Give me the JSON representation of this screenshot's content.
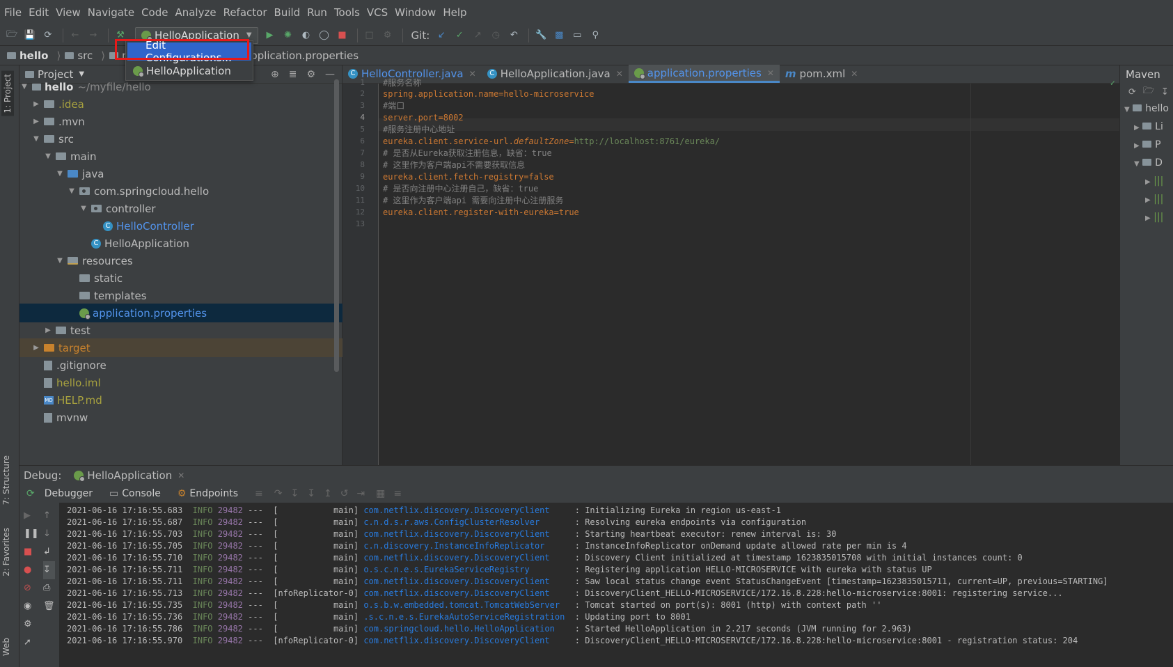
{
  "menubar": [
    "File",
    "Edit",
    "View",
    "Navigate",
    "Code",
    "Analyze",
    "Refactor",
    "Build",
    "Run",
    "Tools",
    "VCS",
    "Window",
    "Help"
  ],
  "toolbar": {
    "run_config": "HelloApplication",
    "git_label": "Git:"
  },
  "run_dropdown": {
    "edit_configurations": "Edit Configurations...",
    "app_item": "HelloApplication"
  },
  "breadcrumb": [
    "hello",
    "src",
    "main",
    "resources",
    "application.properties"
  ],
  "left_stripe": {
    "project": "1: Project",
    "structure": "7: Structure",
    "favorites": "2: Favorites",
    "web": "Web"
  },
  "project_panel": {
    "title": "Project",
    "tree": [
      {
        "label": "hello",
        "suffix": "~/myfile/hello"
      },
      {
        "label": ".idea"
      },
      {
        "label": ".mvn"
      },
      {
        "label": "src"
      },
      {
        "label": "main"
      },
      {
        "label": "java"
      },
      {
        "label": "com.springcloud.hello"
      },
      {
        "label": "controller"
      },
      {
        "label": "HelloController"
      },
      {
        "label": "HelloApplication"
      },
      {
        "label": "resources"
      },
      {
        "label": "static"
      },
      {
        "label": "templates"
      },
      {
        "label": "application.properties"
      },
      {
        "label": "test"
      },
      {
        "label": "target"
      },
      {
        "label": ".gitignore"
      },
      {
        "label": "hello.iml"
      },
      {
        "label": "HELP.md"
      },
      {
        "label": "mvnw"
      }
    ]
  },
  "editor_tabs": [
    {
      "label": "HelloController.java"
    },
    {
      "label": "HelloApplication.java"
    },
    {
      "label": "application.properties"
    },
    {
      "label": "pom.xml"
    }
  ],
  "editor": {
    "line_numbers": [
      "1",
      "2",
      "3",
      "4",
      "5",
      "6",
      "7",
      "8",
      "9",
      "10",
      "11",
      "12",
      "13"
    ],
    "lines": [
      {
        "comment": "#服务名称"
      },
      {
        "key": "spring.application.name",
        "value": "hello-microservice"
      },
      {
        "comment": "#端口"
      },
      {
        "key": "server.port",
        "value": "8002"
      },
      {
        "comment": "#服务注册中心地址"
      },
      {
        "key": "eureka.client.service-url.",
        "key_italic": "defaultZone",
        "value": "http://localhost:8761/eureka/"
      },
      {
        "comment": "# 是否从Eureka获取注册信息，缺省：true"
      },
      {
        "comment": "# 这里作为客户端api不需要获取信息"
      },
      {
        "key": "eureka.client.fetch-registry",
        "value": "false"
      },
      {
        "comment": "# 是否向注册中心注册自己，缺省：true"
      },
      {
        "comment": "# 这里作为客户端api 需要向注册中心注册服务"
      },
      {
        "key": "eureka.client.register-with-eureka",
        "value": "true"
      },
      {}
    ]
  },
  "maven": {
    "title": "Maven",
    "items": [
      "hello",
      "Li",
      "P",
      "D"
    ]
  },
  "debug": {
    "label": "Debug:",
    "session": "HelloApplication",
    "tabs": [
      "Debugger",
      "Console",
      "Endpoints"
    ],
    "log": [
      {
        "ts": "2021-06-16 17:16:55.683",
        "level": "INFO",
        "pid": "29482",
        "thread": "---  [           main]",
        "logger": "com.netflix.discovery.DiscoveryClient   ",
        "msg": ": Initializing Eureka in region us-east-1"
      },
      {
        "ts": "2021-06-16 17:16:55.687",
        "level": "INFO",
        "pid": "29482",
        "thread": "---  [           main]",
        "logger": "c.n.d.s.r.aws.ConfigClusterResolver     ",
        "msg": ": Resolving eureka endpoints via configuration"
      },
      {
        "ts": "2021-06-16 17:16:55.703",
        "level": "INFO",
        "pid": "29482",
        "thread": "---  [           main]",
        "logger": "com.netflix.discovery.DiscoveryClient   ",
        "msg": ": Starting heartbeat executor: renew interval is: 30"
      },
      {
        "ts": "2021-06-16 17:16:55.705",
        "level": "INFO",
        "pid": "29482",
        "thread": "---  [           main]",
        "logger": "c.n.discovery.InstanceInfoReplicator    ",
        "msg": ": InstanceInfoReplicator onDemand update allowed rate per min is 4"
      },
      {
        "ts": "2021-06-16 17:16:55.710",
        "level": "INFO",
        "pid": "29482",
        "thread": "---  [           main]",
        "logger": "com.netflix.discovery.DiscoveryClient   ",
        "msg": ": Discovery Client initialized at timestamp 1623835015708 with initial instances count: 0"
      },
      {
        "ts": "2021-06-16 17:16:55.711",
        "level": "INFO",
        "pid": "29482",
        "thread": "---  [           main]",
        "logger": "o.s.c.n.e.s.EurekaServiceRegistry       ",
        "msg": ": Registering application HELLO-MICROSERVICE with eureka with status UP"
      },
      {
        "ts": "2021-06-16 17:16:55.711",
        "level": "INFO",
        "pid": "29482",
        "thread": "---  [           main]",
        "logger": "com.netflix.discovery.DiscoveryClient   ",
        "msg": ": Saw local status change event StatusChangeEvent [timestamp=1623835015711, current=UP, previous=STARTING]"
      },
      {
        "ts": "2021-06-16 17:16:55.713",
        "level": "INFO",
        "pid": "29482",
        "thread": "---  [nfoReplicator-0]",
        "logger": "com.netflix.discovery.DiscoveryClient   ",
        "msg": ": DiscoveryClient_HELLO-MICROSERVICE/172.16.8.228:hello-microservice:8001: registering service..."
      },
      {
        "ts": "2021-06-16 17:16:55.735",
        "level": "INFO",
        "pid": "29482",
        "thread": "---  [           main]",
        "logger": "o.s.b.w.embedded.tomcat.TomcatWebServer ",
        "msg": ": Tomcat started on port(s): 8001 (http) with context path ''"
      },
      {
        "ts": "2021-06-16 17:16:55.736",
        "level": "INFO",
        "pid": "29482",
        "thread": "---  [           main]",
        "logger": ".s.c.n.e.s.EurekaAutoServiceRegistration",
        "msg": ": Updating port to 8001"
      },
      {
        "ts": "2021-06-16 17:16:55.786",
        "level": "INFO",
        "pid": "29482",
        "thread": "---  [           main]",
        "logger": "com.springcloud.hello.HelloApplication  ",
        "msg": ": Started HelloApplication in 2.217 seconds (JVM running for 2.963)"
      },
      {
        "ts": "2021-06-16 17:16:55.970",
        "level": "INFO",
        "pid": "29482",
        "thread": "---  [nfoReplicator-0]",
        "logger": "com.netflix.discovery.DiscoveryClient   ",
        "msg": ": DiscoveryClient_HELLO-MICROSERVICE/172.16.8.228:hello-microservice:8001 - registration status: 204"
      }
    ]
  },
  "colors": {
    "accent": "#4a88c7",
    "selection": "#2f65ca",
    "highlight_box": "#e51a1a",
    "run": "#59a869",
    "stop": "#d75050"
  }
}
